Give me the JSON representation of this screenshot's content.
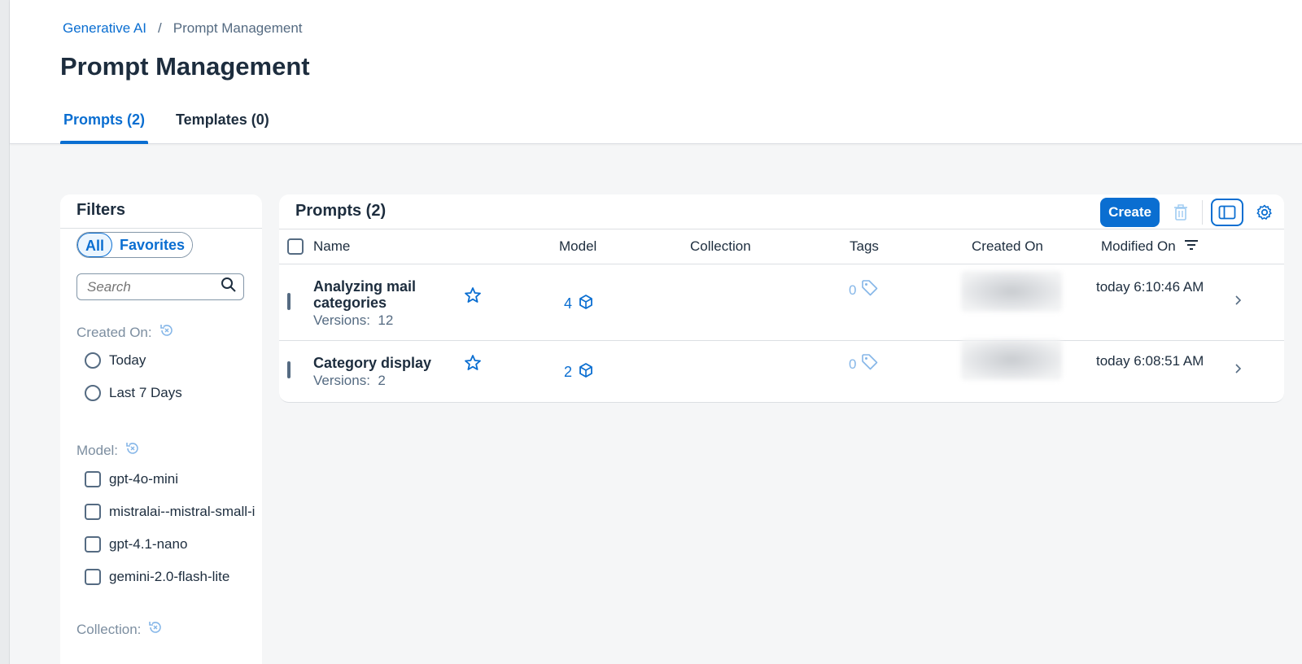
{
  "breadcrumb": {
    "parent": "Generative AI",
    "separator": "/",
    "current": "Prompt Management"
  },
  "page_title": "Prompt Management",
  "tabs": [
    {
      "label": "Prompts (2)",
      "active": true
    },
    {
      "label": "Templates (0)",
      "active": false
    }
  ],
  "filters": {
    "title": "Filters",
    "segments": {
      "all": "All",
      "favorites": "Favorites"
    },
    "search_placeholder": "Search",
    "created_on": {
      "label": "Created On:",
      "options": [
        "Today",
        "Last 7 Days"
      ]
    },
    "model": {
      "label": "Model:",
      "options": [
        "gpt-4o-mini",
        "mistralai--mistral-small-i",
        "gpt-4.1-nano",
        "gemini-2.0-flash-lite"
      ]
    },
    "collection": {
      "label": "Collection:"
    }
  },
  "prompts": {
    "title": "Prompts (2)",
    "create_label": "Create",
    "columns": {
      "name": "Name",
      "model": "Model",
      "collection": "Collection",
      "tags": "Tags",
      "created_on": "Created On",
      "modified_on": "Modified On"
    },
    "rows": [
      {
        "name_line1": "Analyzing mail",
        "name_line2": "categories",
        "versions_label": "Versions:",
        "versions": "12",
        "model_count": "4",
        "tags_count": "0",
        "modified": "today 6:10:46 AM"
      },
      {
        "name_line1": "Category display",
        "versions_label": "Versions:",
        "versions": "2",
        "model_count": "2",
        "tags_count": "0",
        "modified": "today 6:08:51 AM"
      }
    ]
  },
  "colors": {
    "accent": "#0a6ed1",
    "text": "#1d2d3e",
    "muted": "#556b82",
    "background": "#f5f6f7"
  },
  "icons": [
    "search-icon",
    "reset-filter-icon",
    "star-icon",
    "model-cube-icon",
    "tag-icon",
    "delete-icon",
    "side-panel-icon",
    "settings-icon",
    "sort-icon",
    "chevron-right-icon"
  ]
}
